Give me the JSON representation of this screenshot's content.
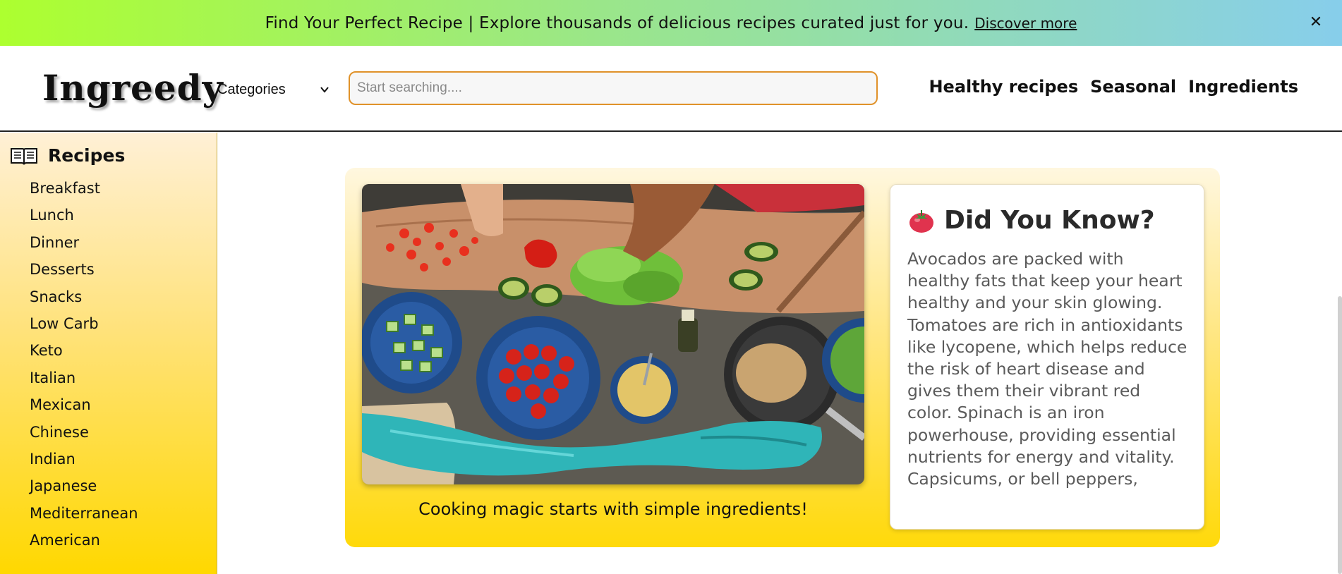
{
  "banner": {
    "text": "Find Your Perfect Recipe | Explore thousands of delicious recipes curated just for you.",
    "link_label": "Discover more",
    "close_label": "✕"
  },
  "header": {
    "logo": "Ingreedy",
    "categories_label": "Categories",
    "search_placeholder": "Start searching....",
    "nav": [
      "Healthy recipes",
      "Seasonal",
      "Ingredients"
    ]
  },
  "sidebar": {
    "title": "Recipes",
    "items": [
      "Breakfast",
      "Lunch",
      "Dinner",
      "Desserts",
      "Snacks",
      "Low Carb",
      "Keto",
      "Italian",
      "Mexican",
      "Chinese",
      "Indian",
      "Japanese",
      "Mediterranean",
      "American"
    ]
  },
  "main": {
    "caption": "Cooking magic starts with simple ingredients!",
    "fact_title": "Did You Know?",
    "fact_text": "Avocados are packed with healthy fats that keep your heart healthy and your skin glowing. Tomatoes are rich in antioxidants like lycopene, which helps reduce the risk of heart disease and gives them their vibrant red color. Spinach is an iron powerhouse, providing essential nutrients for energy and vitality. Capsicums, or bell peppers,"
  },
  "colors": {
    "banner_start": "#adff2f",
    "banner_end": "#87ceeb",
    "search_border": "#e0922a",
    "sidebar_bottom": "#ffd800",
    "panel_bottom": "#ffd90a"
  },
  "icons": {
    "close": "close-icon",
    "categories": "chevron-down-icon",
    "sidebar": "open-book-icon",
    "fact": "tomato-icon"
  }
}
